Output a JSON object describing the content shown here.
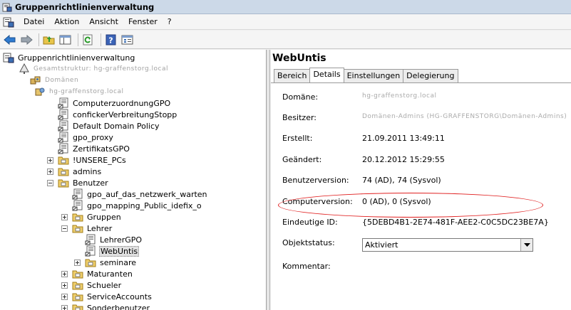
{
  "window": {
    "title": "Gruppenrichtlinienverwaltung"
  },
  "menu": [
    "Datei",
    "Aktion",
    "Ansicht",
    "Fenster",
    "?"
  ],
  "toolbar": [
    "back-icon",
    "forward-icon",
    "up-folder-icon",
    "show-hide-tree-icon",
    "refresh-icon",
    "help-icon",
    "properties-icon"
  ],
  "tree": {
    "root": "Gruppenrichtlinienverwaltung",
    "forest": "Gesamtstruktur: hg-graffenstorg.local",
    "domains": "Domänen",
    "domain": "hg-graffenstorg.local",
    "gpos": [
      "ComputerzuordnungGPO",
      "confickerVerbreitungStopp",
      "Default Domain Policy",
      "gpo_proxy",
      "ZertifikatsGPO"
    ],
    "ous": [
      "!UNSERE_PCs",
      "admins",
      "Benutzer"
    ],
    "benutzer_children": [
      "gpo_auf_das_netzwerk_warten",
      "gpo_mapping_Public_idefix_o",
      "Gruppen",
      "Lehrer"
    ],
    "lehrer_children": [
      "LehrerGPO",
      "WebUntis",
      "seminare"
    ],
    "more_ous": [
      "Maturanten",
      "Schueler",
      "ServiceAccounts",
      "Sonderbenutzer"
    ]
  },
  "details": {
    "title": "WebUntis",
    "tabs": [
      "Bereich",
      "Details",
      "Einstellungen",
      "Delegierung"
    ],
    "active_tab": "Details",
    "labels": {
      "domain": "Domäne:",
      "owner": "Besitzer:",
      "created": "Erstellt:",
      "modified": "Geändert:",
      "user_version": "Benutzerversion:",
      "computer_version": "Computerversion:",
      "unique_id": "Eindeutige ID:",
      "gpo_status": "Objektstatus:",
      "comment": "Kommentar:"
    },
    "values": {
      "domain": "hg-graffenstorg.local",
      "owner": "Domänen-Admins (HG-GRAFFENSTORG\\Domänen-Admins)",
      "created": "21.09.2011 13:49:11",
      "modified": "20.12.2012 15:29:55",
      "user_version": "74 (AD), 74 (Sysvol)",
      "computer_version": "0 (AD), 0 (Sysvol)",
      "unique_id": "{5DEBD4B1-2E74-481F-AEE2-C0C5DC23BE7A}",
      "gpo_status": "Aktiviert"
    }
  },
  "colors": {
    "highlight_ellipse": "#e02020",
    "titlebar": "#ccd9e8"
  }
}
